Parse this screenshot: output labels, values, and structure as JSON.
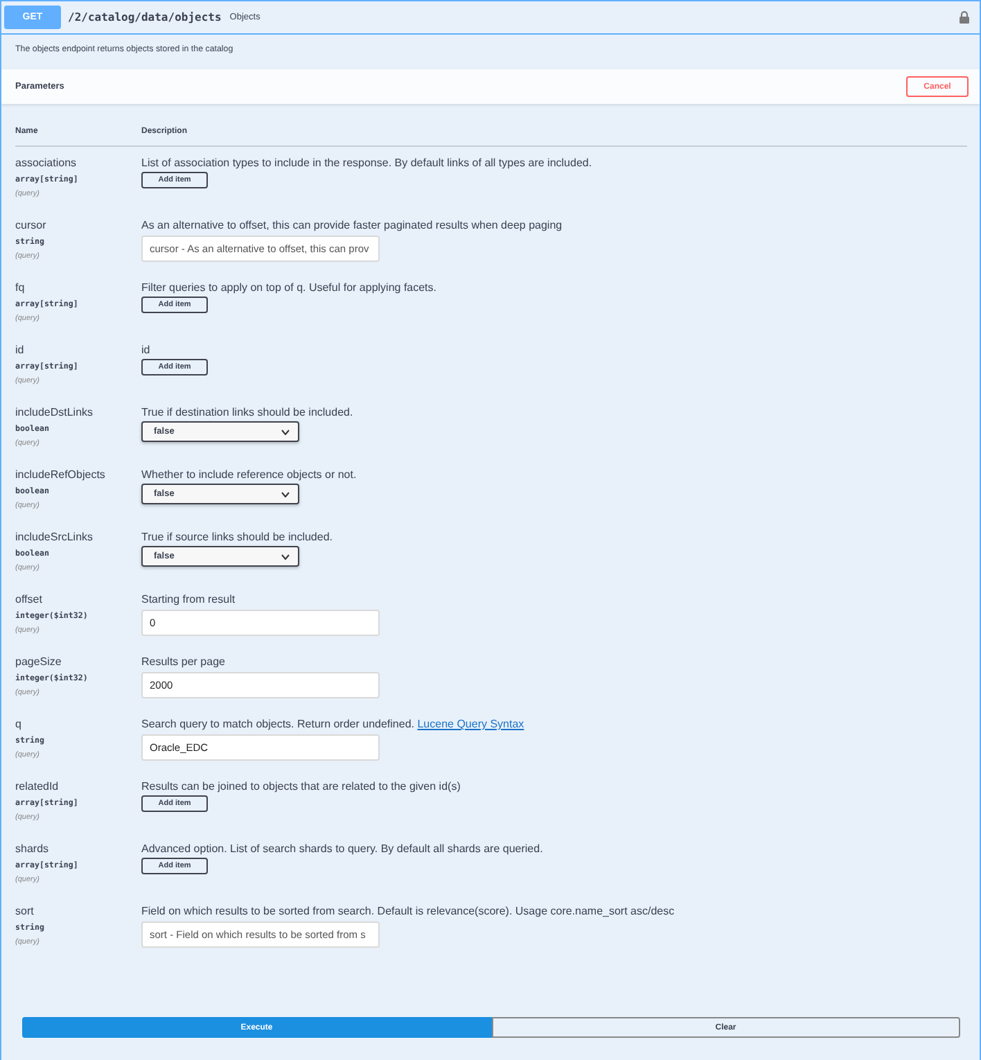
{
  "operation": {
    "method": "GET",
    "path": "/2/catalog/data/objects",
    "summary": "Objects",
    "description": "The objects endpoint returns objects stored in the catalog"
  },
  "parameters_section": {
    "title": "Parameters",
    "cancel": "Cancel",
    "columns": [
      "Name",
      "Description"
    ]
  },
  "parameters": [
    {
      "name": "associations",
      "type": "array[string]",
      "location": "(query)",
      "description": "List of association types to include in the response. By default links of all types are included.",
      "kind": "array",
      "button": "Add item"
    },
    {
      "name": "cursor",
      "type": "string",
      "location": "(query)",
      "description": "As an alternative to offset, this can provide faster paginated results when deep paging",
      "kind": "text",
      "placeholder": "cursor - As an alternative to offset, this can prov"
    },
    {
      "name": "fq",
      "type": "array[string]",
      "location": "(query)",
      "description": "Filter queries to apply on top of q. Useful for applying facets.",
      "kind": "array",
      "button": "Add item"
    },
    {
      "name": "id",
      "type": "array[string]",
      "location": "(query)",
      "description": "id",
      "kind": "array",
      "button": "Add item"
    },
    {
      "name": "includeDstLinks",
      "type": "boolean",
      "location": "(query)",
      "description": "True if destination links should be included.",
      "kind": "select",
      "value": "false"
    },
    {
      "name": "includeRefObjects",
      "type": "boolean",
      "location": "(query)",
      "description": "Whether to include reference objects or not.",
      "kind": "select",
      "value": "false"
    },
    {
      "name": "includeSrcLinks",
      "type": "boolean",
      "location": "(query)",
      "description": "True if source links should be included.",
      "kind": "select",
      "value": "false"
    },
    {
      "name": "offset",
      "type": "integer($int32)",
      "location": "(query)",
      "description": "Starting from result",
      "kind": "text",
      "value": "0"
    },
    {
      "name": "pageSize",
      "type": "integer($int32)",
      "location": "(query)",
      "description": "Results per page",
      "kind": "text",
      "value": "2000"
    },
    {
      "name": "q",
      "type": "string",
      "location": "(query)",
      "description": "Search query to match objects. Return order undefined.",
      "link": "Lucene Query Syntax",
      "kind": "text",
      "value": "Oracle_EDC"
    },
    {
      "name": "relatedId",
      "type": "array[string]",
      "location": "(query)",
      "description": "Results can be joined to objects that are related to the given id(s)",
      "kind": "array",
      "button": "Add item"
    },
    {
      "name": "shards",
      "type": "array[string]",
      "location": "(query)",
      "description": "Advanced option. List of search shards to query. By default all shards are queried.",
      "kind": "array",
      "button": "Add item"
    },
    {
      "name": "sort",
      "type": "string",
      "location": "(query)",
      "description": "Field on which results to be sorted from search. Default is relevance(score). Usage core.name_sort asc/desc",
      "kind": "text",
      "placeholder": "sort - Field on which results to be sorted from s"
    }
  ],
  "actions": [
    {
      "label": "Execute",
      "kind": "primary"
    },
    {
      "label": "Clear",
      "kind": "secondary"
    }
  ]
}
